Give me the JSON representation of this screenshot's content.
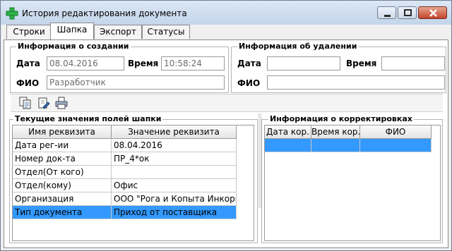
{
  "window": {
    "title": "История редактирования документа",
    "accent": "#3399ff"
  },
  "tabs": [
    {
      "label": "Строки"
    },
    {
      "label": "Шапка",
      "active": true
    },
    {
      "label": "Экспорт"
    },
    {
      "label": "Статусы"
    }
  ],
  "creation": {
    "title": "Информация о создании",
    "date_label": "Дата",
    "date_value": "08.04.2016",
    "time_label": "Время",
    "time_value": "10:58:24",
    "fio_label": "ФИО",
    "fio_value": "Разработчик"
  },
  "deletion": {
    "title": "Информация об удалении",
    "date_label": "Дата",
    "date_value": "",
    "time_label": "Время",
    "time_value": "",
    "fio_label": "ФИО",
    "fio_value": ""
  },
  "toolbar": {
    "icons": [
      "copy-icon",
      "edit-icon",
      "print-icon"
    ]
  },
  "fields_panel": {
    "title": "Текущие значения полей шапки",
    "columns": [
      "Имя реквизита",
      "Значение реквизита"
    ],
    "rows": [
      {
        "name": "Дата рег-ии",
        "value": "08.04.2016"
      },
      {
        "name": "Номер док-та",
        "value": "ПР_4*ок"
      },
      {
        "name": "Отдел(От кого)",
        "value": ""
      },
      {
        "name": "Отдел(кому)",
        "value": "Офис"
      },
      {
        "name": "Организация",
        "value": "ООО \"Рога и Копыта Инкорпо"
      },
      {
        "name": "Тип документа",
        "value": "Приход от поставщика",
        "selected": true
      }
    ]
  },
  "corrections_panel": {
    "title": "Информация о корректировках",
    "columns": [
      "Дата кор.",
      "Время кор.",
      "ФИО"
    ]
  }
}
